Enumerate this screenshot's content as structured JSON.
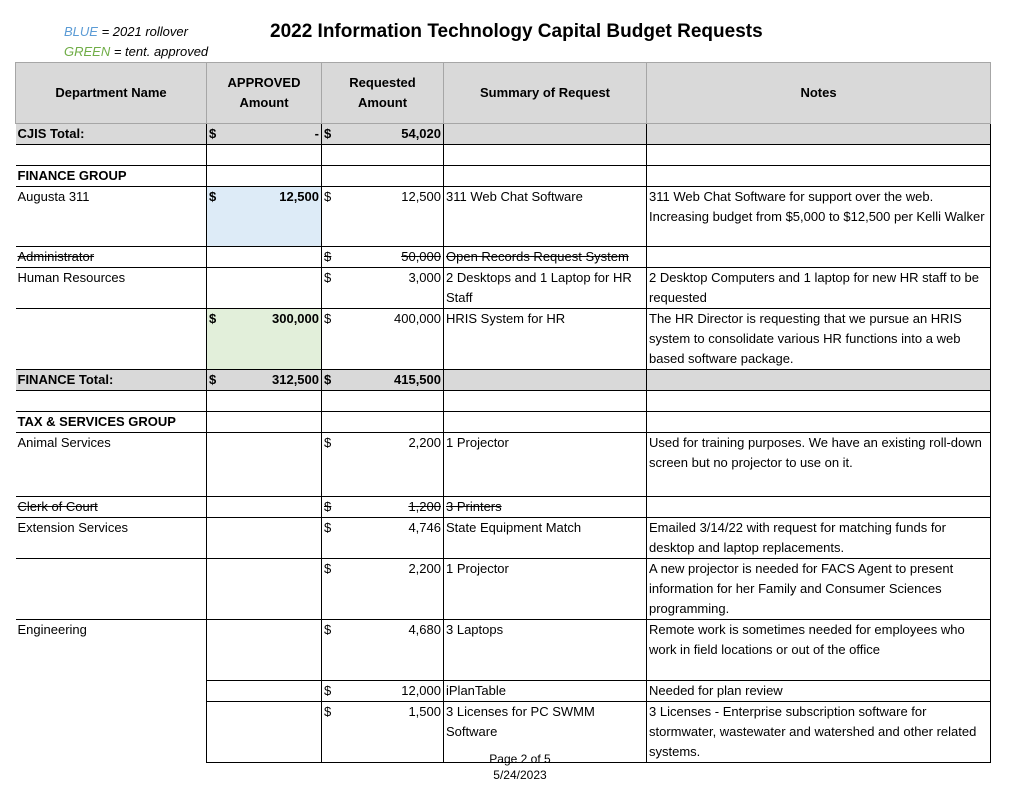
{
  "legend": {
    "blue": "BLUE",
    "blue_desc": " = 2021 rollover",
    "green": "GREEN",
    "green_desc": " = tent. approved"
  },
  "title": "2022 Information Technology Capital Budget Requests",
  "headers": {
    "dept": "Department Name",
    "approved_1": "APPROVED",
    "approved_2": "Amount",
    "requested_1": "Requested",
    "requested_2": "Amount",
    "summary": "Summary of Request",
    "notes": "Notes"
  },
  "currency": "$",
  "cjis": {
    "label": "CJIS Total:",
    "approved": "-",
    "requested": "54,020"
  },
  "finance": {
    "group": "FINANCE GROUP",
    "augusta_dept": "Augusta 311",
    "augusta_approved": "12,500",
    "augusta_requested": "12,500",
    "augusta_summary": "311 Web Chat Software",
    "augusta_notes": "311 Web Chat Software for support over the web. Increasing budget from $5,000 to $12,500 per Kelli Walker",
    "admin_dept": "Administrator",
    "admin_requested": "50,000",
    "admin_summary": "Open Records Request System",
    "hr_dept": "Human Resources",
    "hr1_requested": "3,000",
    "hr1_summary": "2 Desktops and 1 Laptop for HR Staff",
    "hr1_notes": "2 Desktop Computers and 1 laptop for new HR staff to be requested",
    "hr2_approved": "300,000",
    "hr2_requested": "400,000",
    "hr2_summary": "HRIS System for HR",
    "hr2_notes": "The HR Director is requesting that we pursue an HRIS system to consolidate various HR functions into a web based software package.",
    "total_label": "FINANCE Total:",
    "total_approved": "312,500",
    "total_requested": "415,500"
  },
  "tax": {
    "group": "TAX & SERVICES GROUP",
    "animal_dept": "Animal Services",
    "animal_requested": "2,200",
    "animal_summary": "1 Projector",
    "animal_notes": "Used for training purposes. We have an existing roll-down screen but no projector to use on it.",
    "clerk_dept": "Clerk of Court",
    "clerk_requested": "1,200",
    "clerk_summary": "3 Printers",
    "ext_dept": "Extension Services",
    "ext1_requested": "4,746",
    "ext1_summary": "State Equipment Match",
    "ext1_notes": "Emailed 3/14/22 with request for matching funds for desktop and laptop replacements.",
    "ext2_requested": "2,200",
    "ext2_summary": "1 Projector",
    "ext2_notes": "A new projector is needed for FACS Agent to present information for her Family and Consumer Sciences programming.",
    "eng_dept": "Engineering",
    "eng1_requested": "4,680",
    "eng1_summary": "3 Laptops",
    "eng1_notes": "Remote work is sometimes needed for employees who work in field locations or out of the office",
    "eng2_requested": "12,000",
    "eng2_summary": "iPlanTable",
    "eng2_notes": "Needed for plan review",
    "eng3_requested": "1,500",
    "eng3_summary": "3 Licenses for PC SWMM Software",
    "eng3_notes": "3 Licenses - Enterprise subscription software for stormwater, wastewater and watershed and other related systems."
  },
  "footer": {
    "page": "Page 2 of 5",
    "date": "5/24/2023"
  }
}
